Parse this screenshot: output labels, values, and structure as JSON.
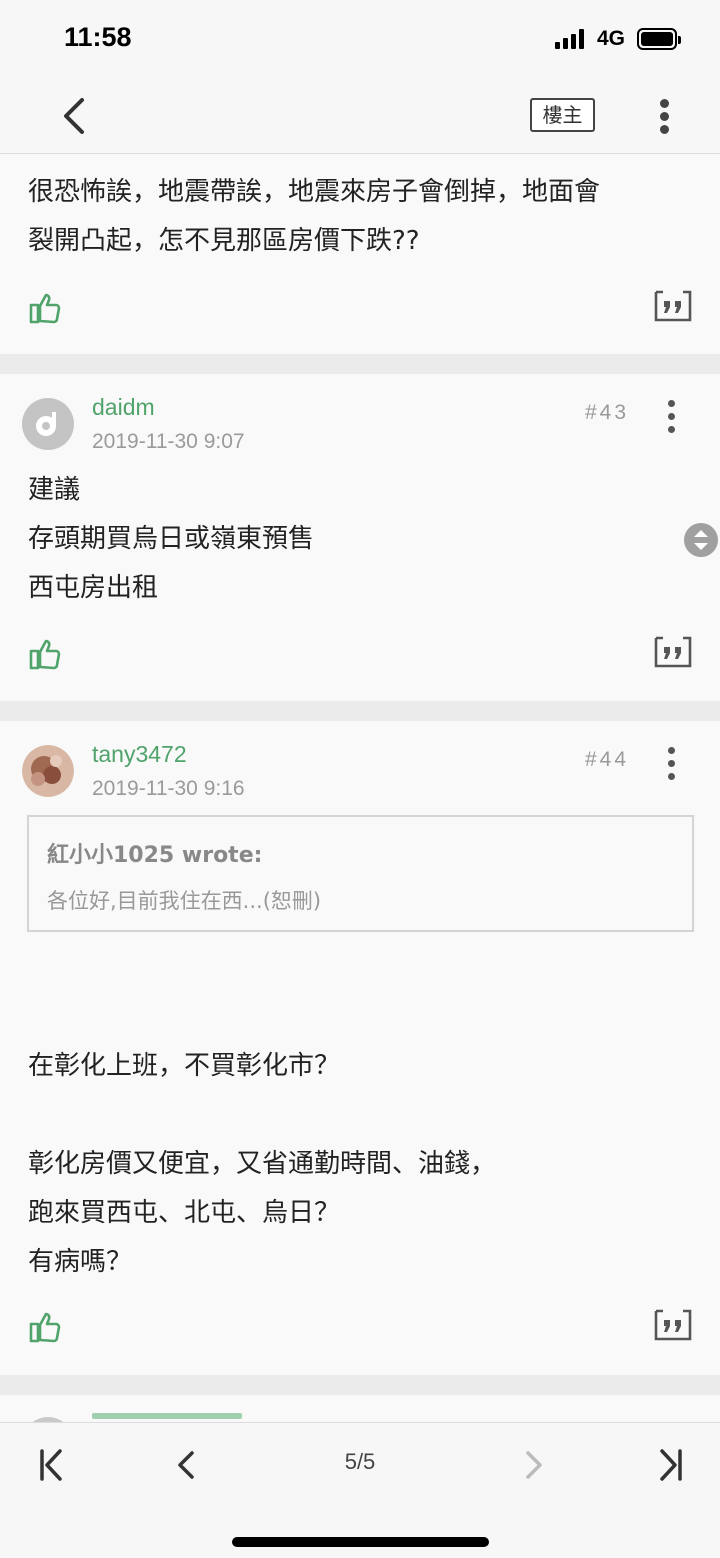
{
  "status_bar": {
    "time": "11:58",
    "network": "4G"
  },
  "nav": {
    "op_label": "樓主"
  },
  "posts": [
    {
      "body_lines": [
        "很恐怖誒，地震帶誒，地震來房子會倒掉，地面會",
        "裂開凸起，怎不見那區房價下跌??"
      ]
    },
    {
      "author": "daidm",
      "timestamp": "2019-11-30 9:07",
      "floor": "#43",
      "body_lines": [
        "建議",
        "存頭期買烏日或嶺東預售",
        "西屯房出租"
      ]
    },
    {
      "author": "tany3472",
      "timestamp": "2019-11-30 9:16",
      "floor": "#44",
      "quote": {
        "author": "紅小小1025 wrote:",
        "text": "各位好,目前我住在西...(恕刪)"
      },
      "body_lines": [
        "在彰化上班，不買彰化市？",
        "",
        "彰化房價又便宜，又省通勤時間、油錢，",
        "跑來買西屯、北屯、烏日？",
        "有病嗎？"
      ]
    }
  ],
  "pagination": {
    "indicator": "5/5"
  },
  "colors": {
    "accent_green": "#4fa36b",
    "background": "#f7f7f7",
    "separator": "#ebebeb"
  }
}
